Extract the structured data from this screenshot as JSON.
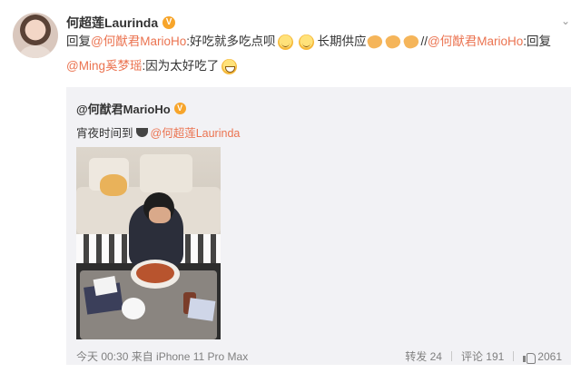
{
  "post": {
    "author": "何超莲Laurinda",
    "verified_badge": "V",
    "text_line1": [
      {
        "type": "text",
        "value": "回复"
      },
      {
        "type": "mention",
        "value": "@何猷君MarioHo"
      },
      {
        "type": "text",
        "value": ":好吃就多吃点呗"
      },
      {
        "type": "text",
        "value": "长期供应"
      },
      {
        "type": "text",
        "value": "//"
      },
      {
        "type": "mention",
        "value": "@何猷君MarioHo"
      },
      {
        "type": "text",
        "value": ":回复"
      }
    ],
    "text_line2": [
      {
        "type": "mention",
        "value": "@Ming奚梦瑶"
      },
      {
        "type": "text",
        "value": ":因为太好吃了"
      }
    ]
  },
  "repost": {
    "author": "@何猷君MarioHo",
    "verified_badge": "V",
    "text": "宵夜时间到",
    "mention": "@何超莲Laurinda",
    "meta": "今天 00:30 来自 iPhone 11 Pro Max",
    "repost_label": "转发 24",
    "comment_label": "评论 191",
    "like_count": "2061"
  },
  "icons": {
    "verified": "verified-badge-icon",
    "menu": "chevron-down-icon",
    "like": "thumbs-up-icon",
    "emoji_smile": "smile-emoji-icon",
    "emoji_hand": "hand-emoji-icon",
    "emoji_grin": "grin-emoji-icon",
    "emoji_bowl": "bowl-emoji-icon"
  },
  "colors": {
    "mention": "#eb7350",
    "verified": "#f7a52b",
    "repost_bg": "#f2f2f5",
    "meta_text": "#808080"
  }
}
